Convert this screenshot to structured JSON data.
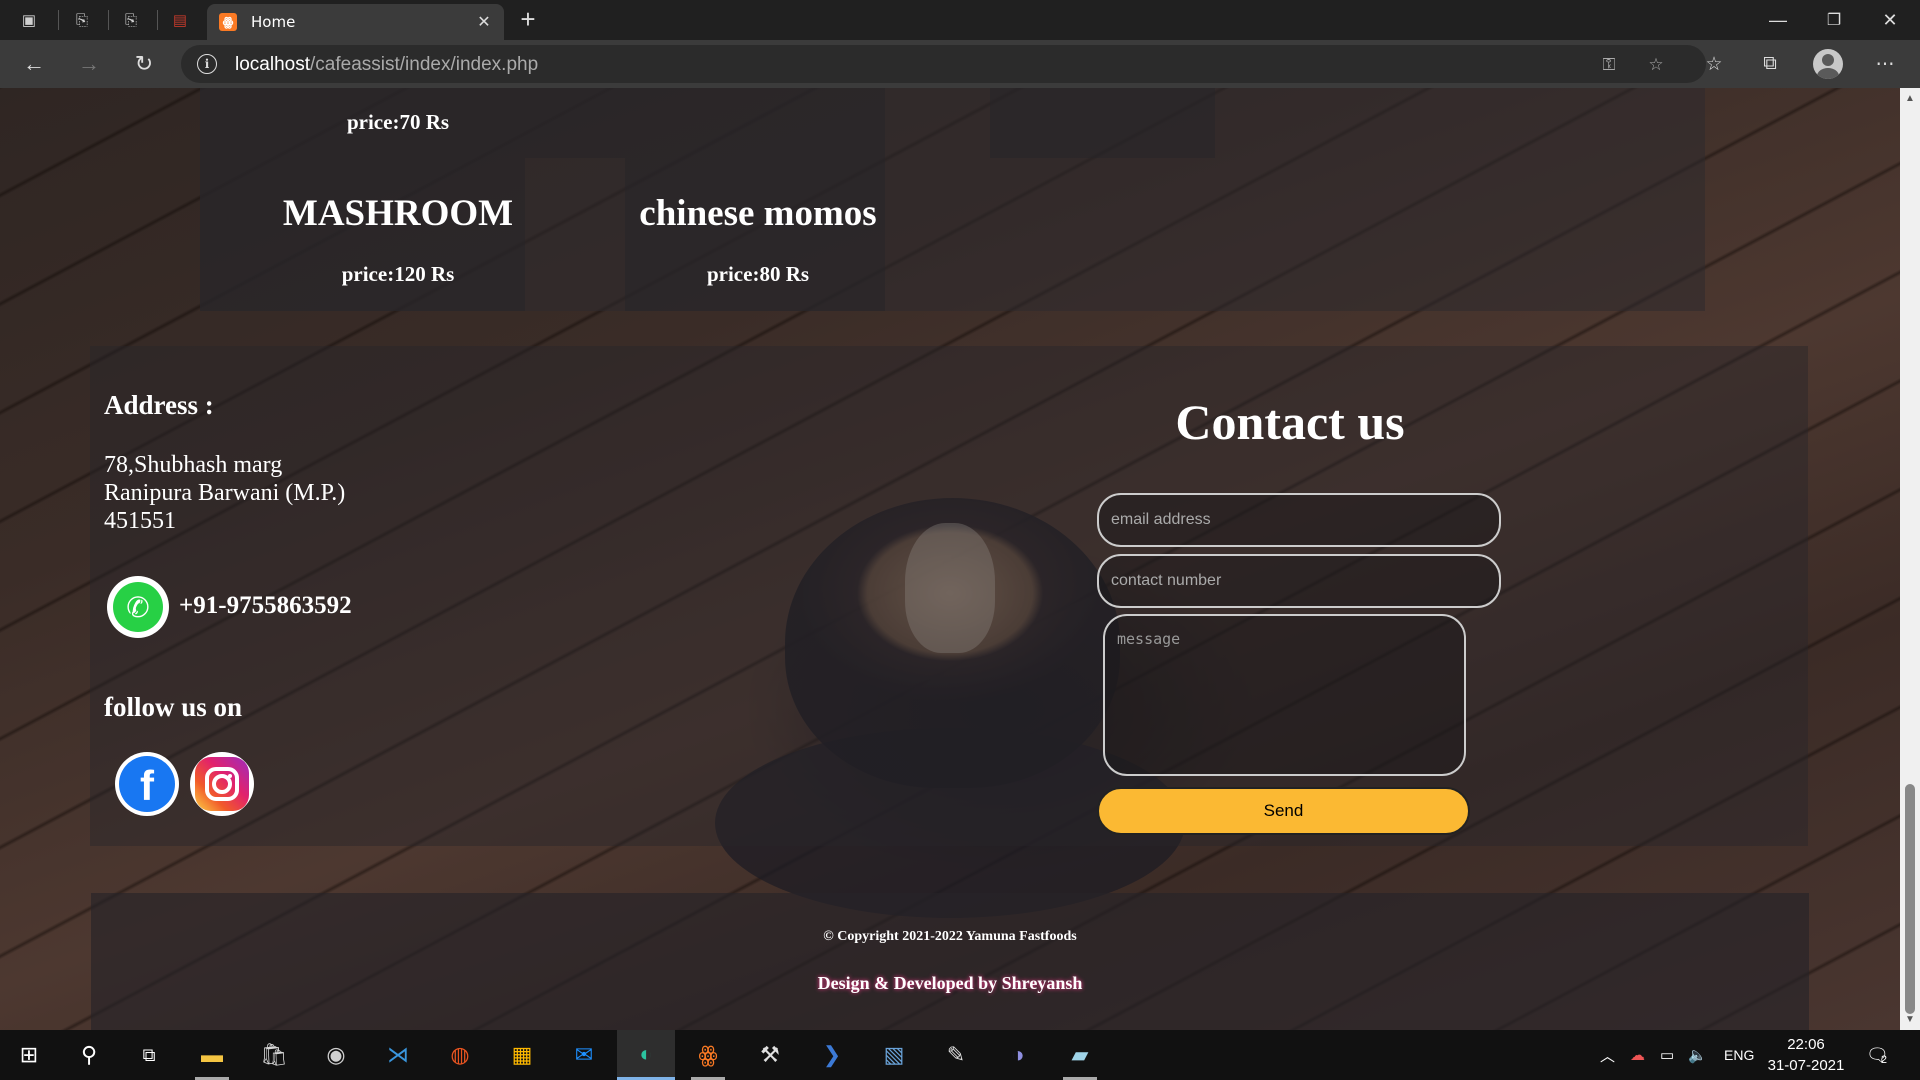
{
  "browser": {
    "tab_title": "Home",
    "url_host": "localhost",
    "url_path": "/cafeassist/index/index.php"
  },
  "menu": {
    "top_row_price": "price:70 Rs",
    "items": [
      {
        "name": "MASHROOM",
        "price": "price:120 Rs"
      },
      {
        "name": "chinese momos",
        "price": "price:80 Rs"
      }
    ]
  },
  "address": {
    "heading": "Address :",
    "line1": "78,Shubhash marg",
    "line2": "Ranipura Barwani (M.P.)",
    "line3": "451551",
    "phone": "+91-9755863592",
    "follow": "follow us on"
  },
  "contact": {
    "title": "Contact us",
    "email_placeholder": "email address",
    "phone_placeholder": "contact number",
    "message_placeholder": "message",
    "send_label": "Send"
  },
  "footer": {
    "copyright": "© Copyright 2021-2022 Yamuna Fastfoods",
    "designed": "Design & Developed by Shreyansh"
  },
  "taskbar": {
    "language": "ENG",
    "time": "22:06",
    "date": "31-07-2021",
    "notifications": "2"
  },
  "colors": {
    "send_button": "#fbb933",
    "tab_favicon": "#fb7a24",
    "whatsapp": "#27d045",
    "facebook": "#1877f2"
  }
}
